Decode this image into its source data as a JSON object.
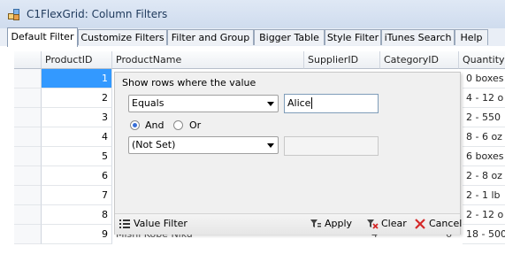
{
  "window": {
    "title": "C1FlexGrid: Column Filters"
  },
  "tabs": [
    {
      "label": "Default Filter",
      "active": true
    },
    {
      "label": "Customize Filters",
      "active": false
    },
    {
      "label": "Filter and Group",
      "active": false
    },
    {
      "label": "Bigger Table",
      "active": false
    },
    {
      "label": "Style Filter",
      "active": false
    },
    {
      "label": "iTunes Search",
      "active": false
    },
    {
      "label": "Help",
      "active": false
    }
  ],
  "grid": {
    "columns": [
      "ProductID",
      "ProductName",
      "SupplierID",
      "CategoryID",
      "Quantity"
    ],
    "rows": [
      {
        "id": "1",
        "qty": "0 boxes"
      },
      {
        "id": "2",
        "qty": "4 - 12 o"
      },
      {
        "id": "3",
        "qty": "2 - 550"
      },
      {
        "id": "4",
        "qty": "8 - 6 oz"
      },
      {
        "id": "5",
        "qty": "6 boxes"
      },
      {
        "id": "6",
        "qty": "2 - 8 oz"
      },
      {
        "id": "7",
        "qty": "2 - 1 lb"
      },
      {
        "id": "8",
        "qty": "2 - 12 o"
      },
      {
        "id": "9",
        "qty": "18 - 500",
        "name": "Mishi Kobe Niku",
        "supplier": "4",
        "category": "6"
      }
    ],
    "selected_row": "1"
  },
  "filter_popup": {
    "prompt": "Show rows where the value",
    "condition1": {
      "operator": "Equals",
      "value": "Alice"
    },
    "logic": {
      "and_label": "And",
      "or_label": "Or",
      "selected": "And"
    },
    "condition2": {
      "operator": "(Not Set)",
      "value": ""
    },
    "footer": {
      "value_filter": "Value Filter",
      "apply": "Apply",
      "clear": "Clear",
      "cancel": "Cancel"
    }
  },
  "colors": {
    "selection": "#3399ff",
    "accent": "#3a6fd8",
    "cancel": "#d42a2a"
  }
}
